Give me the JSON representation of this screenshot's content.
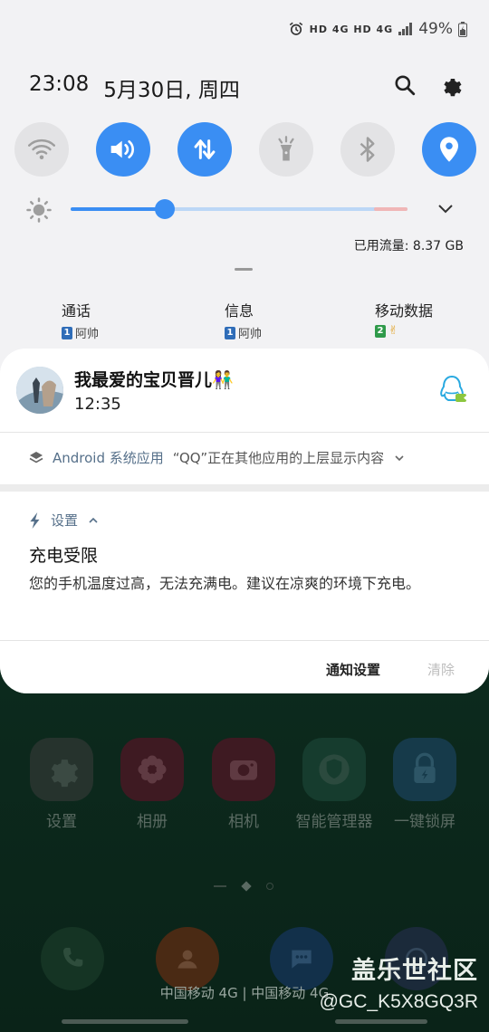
{
  "status_bar": {
    "indicators": "HD 4G HD 4G",
    "battery": "49%"
  },
  "header": {
    "time": "23:08",
    "date": "5月30日, 周四"
  },
  "quick_toggles": [
    {
      "name": "wifi",
      "on": false
    },
    {
      "name": "sound",
      "on": true
    },
    {
      "name": "mobile-data",
      "on": true
    },
    {
      "name": "flashlight",
      "on": false
    },
    {
      "name": "bluetooth",
      "on": false
    },
    {
      "name": "location",
      "on": true
    }
  ],
  "brightness": {
    "level": 0.28
  },
  "data_usage": "已用流量: 8.37 GB",
  "sims": [
    {
      "title": "通话",
      "slot": "1",
      "name": "阿帅"
    },
    {
      "title": "信息",
      "slot": "1",
      "name": "阿帅"
    },
    {
      "title": "移动数据",
      "slot": "2",
      "name": "✌"
    }
  ],
  "qq_notification": {
    "name": "我最爱的宝贝晋儿👫",
    "time": "12:35"
  },
  "android_notice": {
    "app": "Android 系统应用",
    "text": "“QQ”正在其他应用的上层显示内容"
  },
  "settings_notice": {
    "app": "设置",
    "title": "充电受限",
    "body": "您的手机温度过高，无法充满电。建议在凉爽的环境下充电。"
  },
  "actions": {
    "notification_settings": "通知设置",
    "clear": "清除"
  },
  "home_apps": [
    {
      "label": "设置"
    },
    {
      "label": "相册"
    },
    {
      "label": "相机"
    },
    {
      "label": "智能管理器"
    },
    {
      "label": "一键锁屏"
    }
  ],
  "carrier": "中国移动 4G | 中国移动 4G",
  "watermark": {
    "site": "盖乐世社区",
    "user": "@GC_K5X8GQ3R"
  }
}
